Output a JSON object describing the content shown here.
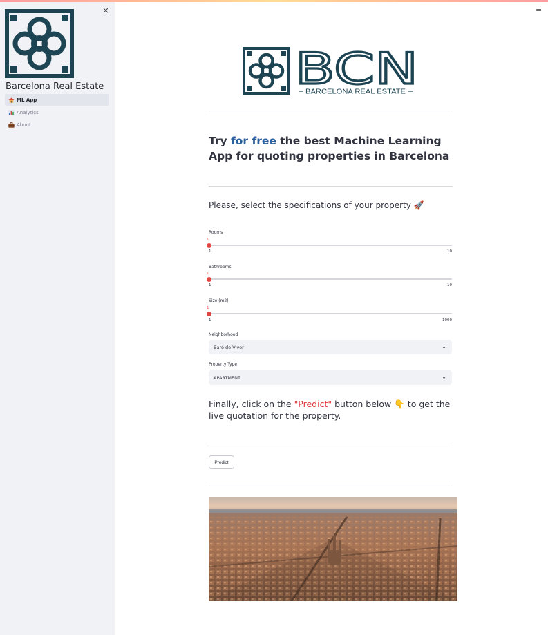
{
  "sidebar": {
    "close_icon": "×",
    "logo": {
      "name": "barcelona-tile-logo",
      "color": "#1d4452"
    },
    "title": "Barcelona Real Estate",
    "items": [
      {
        "label": "ML App",
        "icon": "house-icon",
        "active": true
      },
      {
        "label": "Analytics",
        "icon": "bar-chart-icon",
        "active": false
      },
      {
        "label": "About",
        "icon": "briefcase-icon",
        "active": false
      }
    ]
  },
  "header": {
    "menu_icon": "≡"
  },
  "logo": {
    "text": "BCN",
    "subtitle": "BARCELONA REAL ESTATE",
    "color": "#1d4452"
  },
  "intro": {
    "prefix": "Try ",
    "highlight": "for free",
    "suffix": " the best Machine Learning App for quoting properties in Barcelona",
    "highlight_color": "#2a5f9e"
  },
  "prompt": {
    "text": "Please, select the specifications of your property",
    "emoji": "🚀"
  },
  "sliders": [
    {
      "label": "Rooms",
      "value": "1",
      "min": "1",
      "max": "10"
    },
    {
      "label": "Bathrooms",
      "value": "1",
      "min": "1",
      "max": "10"
    },
    {
      "label": "Size (m2)",
      "value": "1",
      "min": "1",
      "max": "1000"
    }
  ],
  "selects": [
    {
      "label": "Neighborhood",
      "value": "Baró de Viver"
    },
    {
      "label": "Property Type",
      "value": "APARTMENT"
    }
  ],
  "final": {
    "prefix": "Finally, click on the ",
    "highlight": "\"Predict\"",
    "middle": " button below ",
    "emoji": "👇",
    "suffix": " to get the live quotation for the property.",
    "highlight_color": "#e0383b"
  },
  "predict_button": {
    "label": "Predict"
  },
  "accent_color": "#ff4b4b"
}
